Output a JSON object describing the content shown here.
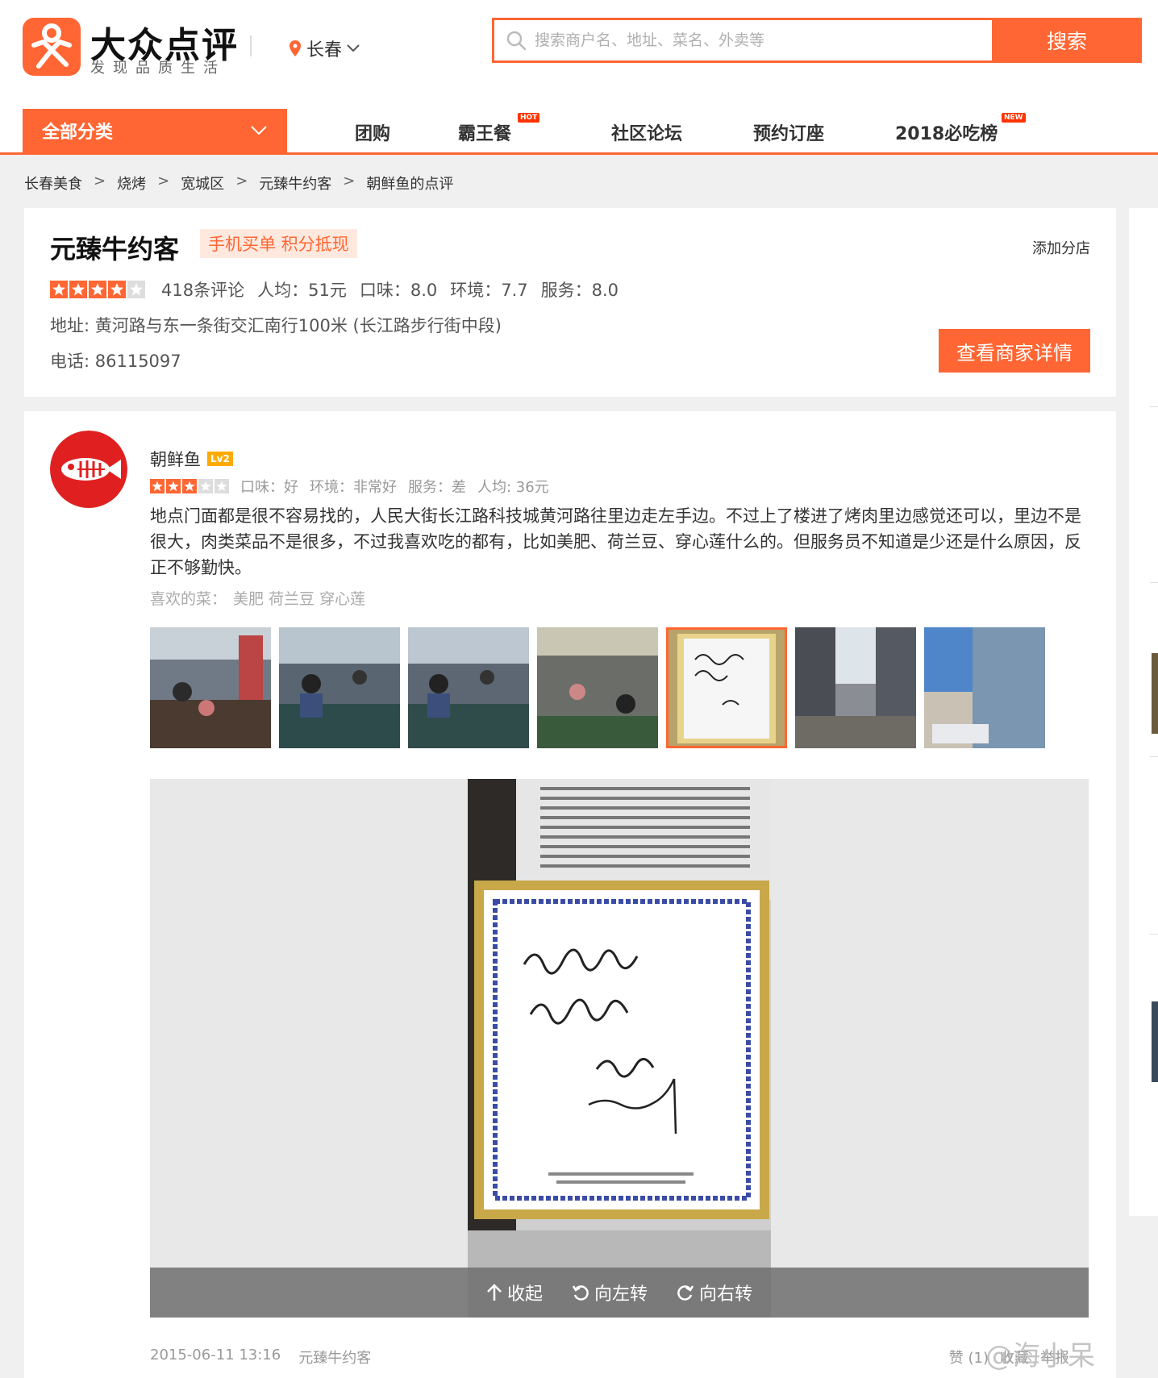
{
  "header": {
    "logo_name": "大众点评",
    "logo_slogan": "发现品质生活",
    "city": "长春",
    "search_placeholder": "搜索商户名、地址、菜名、外卖等",
    "search_button": "搜索",
    "brand_color": "#ff6633"
  },
  "nav": {
    "all_categories": "全部分类",
    "items": [
      {
        "label": "团购",
        "badge": ""
      },
      {
        "label": "霸王餐",
        "badge": "HOT"
      },
      {
        "label": "社区论坛",
        "badge": ""
      },
      {
        "label": "预约订座",
        "badge": ""
      },
      {
        "label": "2018必吃榜",
        "badge": "NEW"
      }
    ]
  },
  "breadcrumb": [
    "长春美食",
    "烧烤",
    "宽城区",
    "元臻牛约客",
    "朝鲜鱼的点评"
  ],
  "shop": {
    "name": "元臻牛约客",
    "tag": "手机买单 积分抵现",
    "add_branch": "添加分店",
    "stars": 4,
    "review_count": "418条评论",
    "avg_price": "人均：51元",
    "taste": "口味：8.0",
    "environment": "环境：7.7",
    "service": "服务：8.0",
    "address": "地址: 黄河路与东一条街交汇南行100米 (长江路步行街中段)",
    "phone": "电话: 86115097",
    "detail_button": "查看商家详情"
  },
  "review": {
    "reviewer": "朝鲜鱼",
    "level": "Lv2",
    "stars": 3,
    "taste": "口味：好",
    "environment": "环境：非常好",
    "service": "服务：差",
    "avg_price": "人均: 36元",
    "text": "地点门面都是很不容易找的，人民大街长江路科技城黄河路往里边走左手边。不过上了楼进了烤肉里边感觉还可以，里边不是很大，肉类菜品不是很多，不过我喜欢吃的都有，比如美肥、荷兰豆、穿心莲什么的。但服务员不知道是少还是什么原因，反正不够勤快。",
    "liked_label": "喜欢的菜：",
    "liked_dishes": "美肥 荷兰豆 穿心莲",
    "viewer_actions": [
      "收起",
      "向左转",
      "向右转"
    ],
    "date": "2015-06-11 13:16",
    "shop_link": "元臻牛约客",
    "actions": [
      "赞 (1)",
      "收藏",
      "举报"
    ]
  },
  "watermark": "@海小呆"
}
